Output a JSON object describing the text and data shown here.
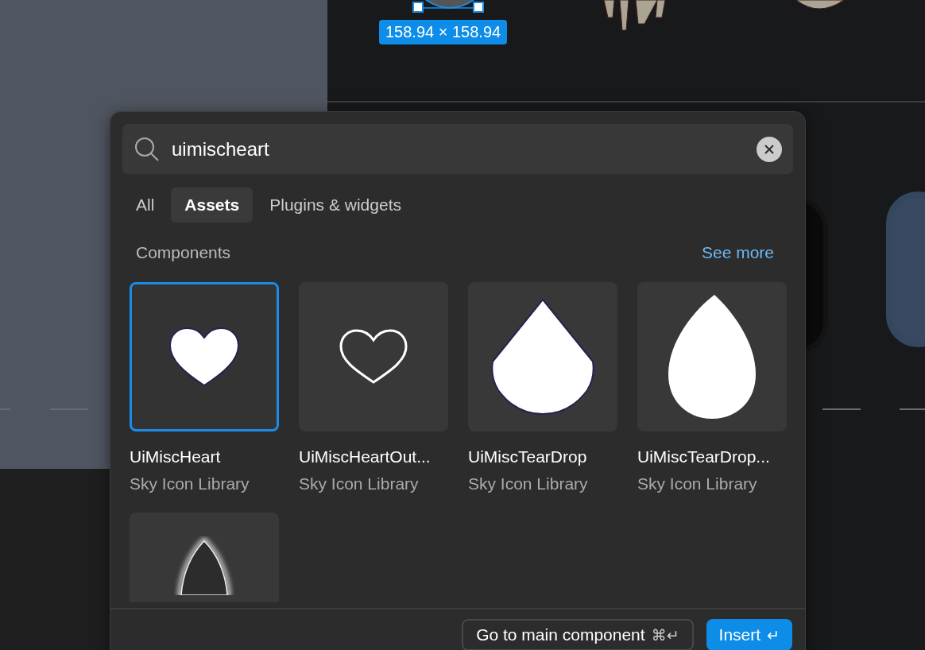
{
  "canvas": {
    "dimension_label": "158.94 × 158.94"
  },
  "search": {
    "value": "uimischeart"
  },
  "tabs": [
    {
      "label": "All",
      "selected": false
    },
    {
      "label": "Assets",
      "selected": true
    },
    {
      "label": "Plugins & widgets",
      "selected": false
    }
  ],
  "section": {
    "title": "Components",
    "link": "See more"
  },
  "results": [
    {
      "kind": "heart",
      "name": "UiMiscHeart",
      "library": "Sky Icon Library",
      "selected": true
    },
    {
      "kind": "heart-outline",
      "name": "UiMiscHeartOut...",
      "library": "Sky Icon Library",
      "selected": false
    },
    {
      "kind": "teardrop",
      "name": "UiMiscTearDrop",
      "library": "Sky Icon Library",
      "selected": false
    },
    {
      "kind": "teardrop-tall",
      "name": "UiMiscTearDrop...",
      "library": "Sky Icon Library",
      "selected": false
    },
    {
      "kind": "tip",
      "selected": false
    }
  ],
  "footer": {
    "secondary": {
      "label": "Go to main component",
      "shortcut": "⌘↵"
    },
    "primary": {
      "label": "Insert",
      "shortcut": "↵"
    }
  }
}
